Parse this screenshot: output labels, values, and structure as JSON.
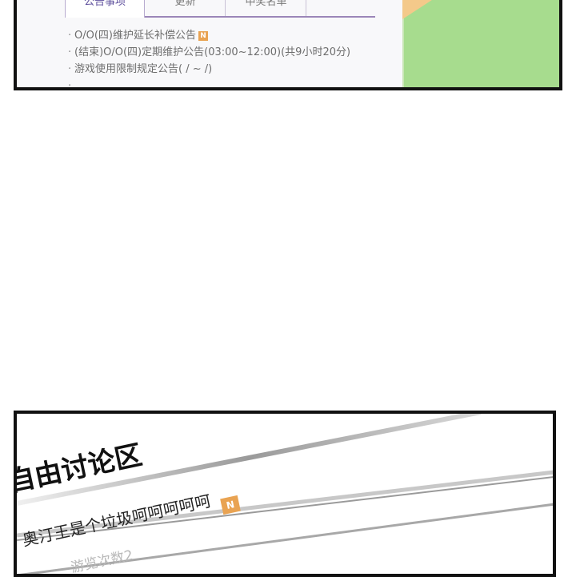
{
  "notice_board": {
    "tabs": [
      {
        "label": "公告事项",
        "active": true
      },
      {
        "label": "更新",
        "active": false
      },
      {
        "label": "中奖名单",
        "active": false
      }
    ],
    "items": [
      {
        "text": "O/O(四)维护延长补偿公告",
        "new": true
      },
      {
        "text": "(结束)O/O(四)定期维护公告(03:00~12:00)(共9小时20分)",
        "new": false
      },
      {
        "text": "游戏使用限制规定公告( / ~ /)",
        "new": false
      }
    ],
    "bullet": "·",
    "new_badge": "N"
  },
  "forum": {
    "title": "自由讨论区",
    "post_title": "奥汀王是个垃圾呵呵呵呵呵",
    "post_badge": "N",
    "post_meta": "游览次数2"
  },
  "colors": {
    "tab_accent": "#5b4c9b",
    "badge": "#e9a352",
    "green_panel": "#a7dc8e"
  }
}
